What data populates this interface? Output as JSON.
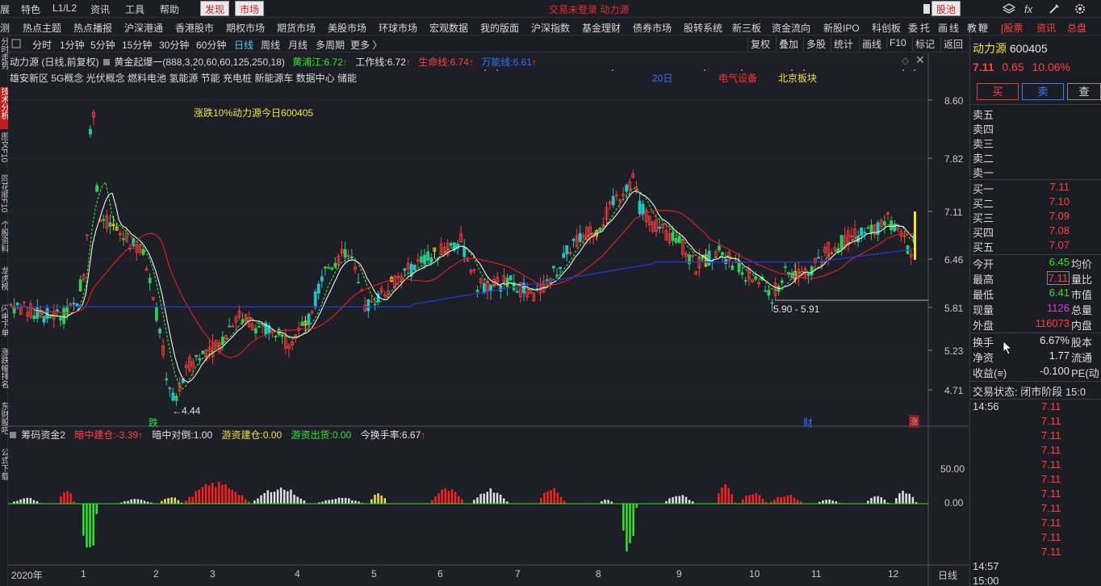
{
  "menubar": {
    "items": [
      "展",
      "特色",
      "L1/L2",
      "资讯",
      "工具",
      "帮助"
    ],
    "discover": "发现",
    "market": "市场",
    "center_title": "交易未登录  动力源",
    "stock_pool": "股池"
  },
  "navbar": {
    "items": [
      "测",
      "热点主题",
      "热点播报",
      "沪深港通",
      "香港股市",
      "期权市场",
      "期货市场",
      "美股市场",
      "环球市场",
      "宏观数据",
      "我的版面",
      "沪深指数",
      "基金理财",
      "债券市场",
      "股转系统",
      "新三板",
      "资金流向",
      "新股IPO",
      "科创板",
      "委",
      "托",
      "画",
      "线",
      "教",
      "鞭"
    ],
    "right_tabs": [
      "[股票",
      "资讯",
      "总盘"
    ]
  },
  "toolbar": {
    "periods": [
      "分时",
      "1分钟",
      "5分钟",
      "15分钟",
      "30分钟",
      "60分钟",
      "日线",
      "周线",
      "月线",
      "多周期",
      "更多 〉"
    ],
    "buttons": [
      "复权",
      "叠加",
      "多股",
      "统计",
      "画线",
      "F10",
      "标记",
      "返回"
    ]
  },
  "leftstrip": [
    "分时走势",
    "技术分析",
    "图文F10",
    "同花顺F10",
    "个股资料",
    "龙虎榜",
    "闪电下单",
    "涨跌幅排名",
    "东财股吧",
    "公式下载"
  ],
  "indicator_bar": {
    "name": "动力源 (日线,前复权)",
    "formula": "黄金起爆一(888,3,20,60,60,125,250,18)",
    "l1_label": "黄浦江:",
    "l1_value": "6.72",
    "l2_label": "工作线:",
    "l2_value": "6.72",
    "l3_label": "生命线:",
    "l3_value": "6.74",
    "l4_label": "万能线:",
    "l4_value": "6.61"
  },
  "concepts": "雄安新区 5G概念 光伏概念 燃料电池 氢能源 节能 充电桩 新能源车 数据中心 储能",
  "tags": {
    "t1": "20日",
    "t2": "电气设备",
    "t3": "北京板块"
  },
  "annotation": "涨跌10%动力源今日600405",
  "price_axis": [
    "8.60",
    "7.82",
    "7.11",
    "6.46",
    "5.81",
    "5.23",
    "4.71"
  ],
  "low_label": "4.44",
  "range_label": "5.90 - 5.91",
  "markers": {
    "die": "跌",
    "cai": "财",
    "zhang": "涨"
  },
  "lower_indicator": {
    "name": "筹码资金2",
    "a_label": "暗中建仓:",
    "a_value": "-3.39",
    "b_label": "暗中对倒:",
    "b_value": "1.00",
    "c_label": "游资建仓:",
    "c_value": "0.00",
    "d_label": "游资出货:",
    "d_value": "0.00",
    "e_label": "今换手率:",
    "e_value": "6.67"
  },
  "lower_axis": [
    "50.00",
    "0.00"
  ],
  "time_axis": {
    "year": "2020年",
    "months": [
      "1",
      "2",
      "3",
      "4",
      "5",
      "6",
      "7",
      "8",
      "9",
      "10",
      "11",
      "12"
    ],
    "period": "日线"
  },
  "quote": {
    "name": "动力源",
    "code": "600405",
    "price": "7.11",
    "change": "0.65",
    "pct": "10.06%",
    "buy": "买",
    "sell": "卖",
    "query": "查",
    "asks": [
      "卖五",
      "卖四",
      "卖三",
      "卖二",
      "卖一"
    ],
    "bids": [
      {
        "label": "买一",
        "price": "7.11"
      },
      {
        "label": "买二",
        "price": "7.10"
      },
      {
        "label": "买三",
        "price": "7.09"
      },
      {
        "label": "买四",
        "price": "7.08"
      },
      {
        "label": "买五",
        "price": "7.07"
      }
    ],
    "stats": [
      {
        "k": "今开",
        "v": "6.45",
        "k2": "均价",
        "c": "green"
      },
      {
        "k": "最高",
        "v": "7.11",
        "k2": "量比",
        "c": "red"
      },
      {
        "k": "最低",
        "v": "6.41",
        "k2": "市值",
        "c": "green"
      },
      {
        "k": "现量",
        "v": "1126",
        "k2": "总量",
        "c": "purple"
      },
      {
        "k": "外盘",
        "v": "116073",
        "k2": "内盘",
        "c": "red"
      }
    ],
    "stats2": [
      {
        "k": "换手",
        "v": "6.67%",
        "k2": "股本"
      },
      {
        "k": "净资",
        "v": "1.77",
        "k2": "流通"
      },
      {
        "k": "收益(≡)",
        "v": "-0.100",
        "k2": "PE(动"
      }
    ],
    "trade_status_label": "交易状态:",
    "trade_status": "闭市阶段 15:0",
    "ticks_time1": "14:56",
    "ticks_time2": "14:57",
    "ticks_time3": "15:00",
    "tick_price": "7.11"
  }
}
